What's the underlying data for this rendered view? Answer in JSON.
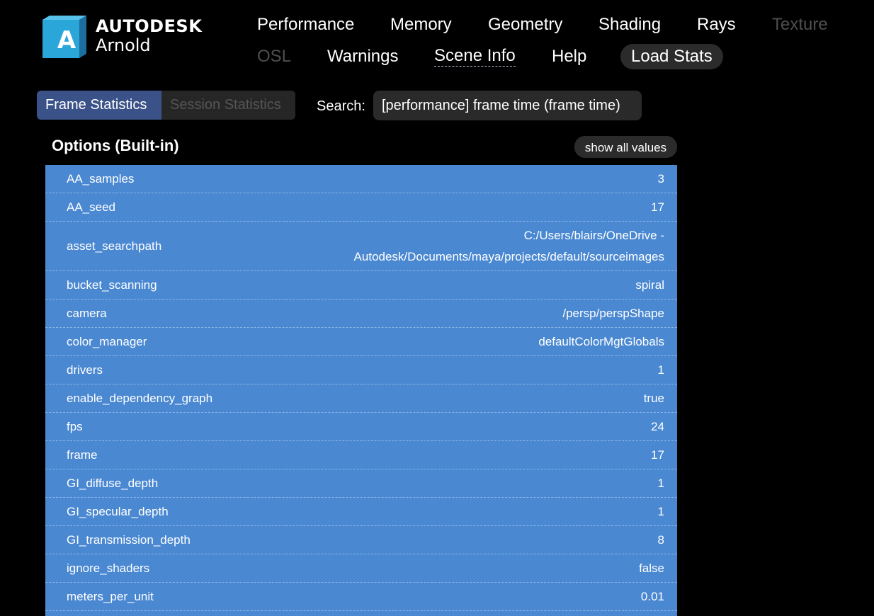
{
  "brand": {
    "company": "AUTODESK",
    "product": "Arnold",
    "logo_letter": "A",
    "colors": {
      "logo_front": "#2aa7d8",
      "logo_side": "#1c6f9c",
      "logo_top": "#58c3ea"
    }
  },
  "nav": {
    "row1": [
      {
        "label": "Performance",
        "enabled": true
      },
      {
        "label": "Memory",
        "enabled": true
      },
      {
        "label": "Geometry",
        "enabled": true
      },
      {
        "label": "Shading",
        "enabled": true
      },
      {
        "label": "Rays",
        "enabled": true
      },
      {
        "label": "Texture",
        "enabled": false
      }
    ],
    "row2": [
      {
        "label": "OSL",
        "enabled": false
      },
      {
        "label": "Warnings",
        "enabled": true
      },
      {
        "label": "Scene Info",
        "enabled": true,
        "selected": true
      },
      {
        "label": "Help",
        "enabled": true
      }
    ],
    "load_stats_label": "Load Stats"
  },
  "stats_toggle": {
    "frame_label": "Frame Statistics",
    "session_label": "Session Statistics",
    "active": "frame"
  },
  "search": {
    "label": "Search:",
    "value": "[performance] frame time (frame time)"
  },
  "section": {
    "title": "Options (Built-in)",
    "show_all_label": "show all values"
  },
  "table": {
    "rows": [
      {
        "key": "AA_samples",
        "value": "3"
      },
      {
        "key": "AA_seed",
        "value": "17"
      },
      {
        "key": "asset_searchpath",
        "value": "C:/Users/blairs/OneDrive - Autodesk/Documents/maya/projects/default/sourceimages"
      },
      {
        "key": "bucket_scanning",
        "value": "spiral"
      },
      {
        "key": "camera",
        "value": "/persp/perspShape"
      },
      {
        "key": "color_manager",
        "value": "defaultColorMgtGlobals"
      },
      {
        "key": "drivers",
        "value": "1"
      },
      {
        "key": "enable_dependency_graph",
        "value": "true"
      },
      {
        "key": "fps",
        "value": "24"
      },
      {
        "key": "frame",
        "value": "17"
      },
      {
        "key": "GI_diffuse_depth",
        "value": "1"
      },
      {
        "key": "GI_specular_depth",
        "value": "1"
      },
      {
        "key": "GI_transmission_depth",
        "value": "8"
      },
      {
        "key": "ignore_shaders",
        "value": "false"
      },
      {
        "key": "meters_per_unit",
        "value": "0.01"
      }
    ]
  },
  "colors": {
    "background": "#000000",
    "table_bg": "#4a88d2",
    "active_toggle": "#3a5287",
    "pill_bg": "#2b2b2b",
    "disabled_text": "#4f4f4f"
  }
}
